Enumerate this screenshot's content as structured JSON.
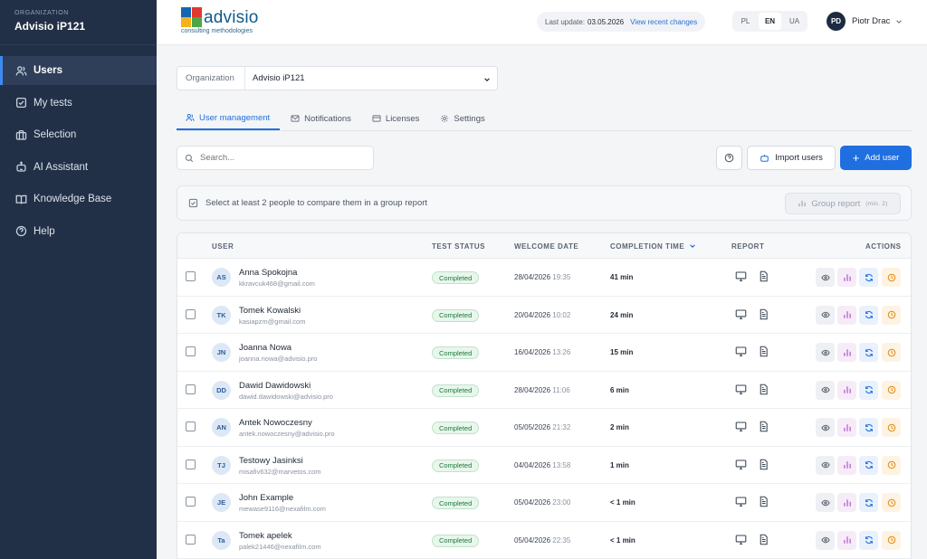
{
  "sidebar": {
    "org_caption": "ORGANIZATION",
    "org_name": "Advisio iP121",
    "items": [
      {
        "label": "Users",
        "icon": "users-icon"
      },
      {
        "label": "My tests",
        "icon": "checkbox-icon"
      },
      {
        "label": "Selection",
        "icon": "briefcase-icon"
      },
      {
        "label": "AI Assistant",
        "icon": "robot-icon"
      },
      {
        "label": "Knowledge Base",
        "icon": "book-icon"
      },
      {
        "label": "Help",
        "icon": "help-circle-icon"
      }
    ]
  },
  "header": {
    "logo_text": "advisio",
    "logo_sub": "consulting methodologies",
    "last_update_label": "Last update:",
    "last_update_date": "03.05.2026",
    "view_changes": "View recent changes",
    "languages": [
      "PL",
      "EN",
      "UA"
    ],
    "active_language": "EN",
    "user_initials": "PD",
    "user_name": "Piotr Drac"
  },
  "org_select": {
    "label": "Organization",
    "value": "Advisio iP121"
  },
  "tabs": [
    {
      "label": "User management",
      "icon": "users-icon"
    },
    {
      "label": "Notifications",
      "icon": "mail-icon"
    },
    {
      "label": "Licenses",
      "icon": "card-icon"
    },
    {
      "label": "Settings",
      "icon": "gear-icon"
    }
  ],
  "toolbar": {
    "search_placeholder": "Search...",
    "import_label": "Import users",
    "add_label": "Add user"
  },
  "compare_bar": {
    "text": "Select at least 2 people to compare them in a group report",
    "group_label": "Group report",
    "group_hint": "(min. 2)"
  },
  "table": {
    "headers": {
      "user": "USER",
      "status": "TEST STATUS",
      "welcome": "WELCOME DATE",
      "completion": "COMPLETION TIME",
      "report": "REPORT",
      "actions": "ACTIONS"
    },
    "rows": [
      {
        "initials": "AS",
        "name": "Anna Spokojna",
        "email": "kkravcuk468@gmail.com",
        "status": "Completed",
        "date": "28/04/2026",
        "time": "19:35",
        "duration": "41 min"
      },
      {
        "initials": "TK",
        "name": "Tomek Kowalski",
        "email": "kasiapzm@gmail.com",
        "status": "Completed",
        "date": "20/04/2026",
        "time": "10:02",
        "duration": "24 min"
      },
      {
        "initials": "JN",
        "name": "Joanna Nowa",
        "email": "joanna.nowa@advisio.pro",
        "status": "Completed",
        "date": "16/04/2026",
        "time": "13:26",
        "duration": "15 min"
      },
      {
        "initials": "DD",
        "name": "Dawid Dawidowski",
        "email": "dawid.dawidowski@advisio.pro",
        "status": "Completed",
        "date": "28/04/2026",
        "time": "11:06",
        "duration": "6 min"
      },
      {
        "initials": "AN",
        "name": "Antek Nowoczesny",
        "email": "antek.nowoczesny@advisio.pro",
        "status": "Completed",
        "date": "05/05/2026",
        "time": "21:32",
        "duration": "2 min"
      },
      {
        "initials": "TJ",
        "name": "Testowy Jasinksi",
        "email": "misafiv632@marvetos.com",
        "status": "Completed",
        "date": "04/04/2026",
        "time": "13:58",
        "duration": "1 min"
      },
      {
        "initials": "JE",
        "name": "John Example",
        "email": "mewase9116@nexafilm.com",
        "status": "Completed",
        "date": "05/04/2026",
        "time": "23:00",
        "duration": "< 1 min"
      },
      {
        "initials": "Ta",
        "name": "Tomek apelek",
        "email": "palek21446@nexafilm.com",
        "status": "Completed",
        "date": "05/04/2026",
        "time": "22:35",
        "duration": "< 1 min"
      }
    ]
  },
  "colors": {
    "sidebar_bg": "#223047",
    "accent": "#1f6fe0",
    "status_green": "#1b7a3a"
  }
}
